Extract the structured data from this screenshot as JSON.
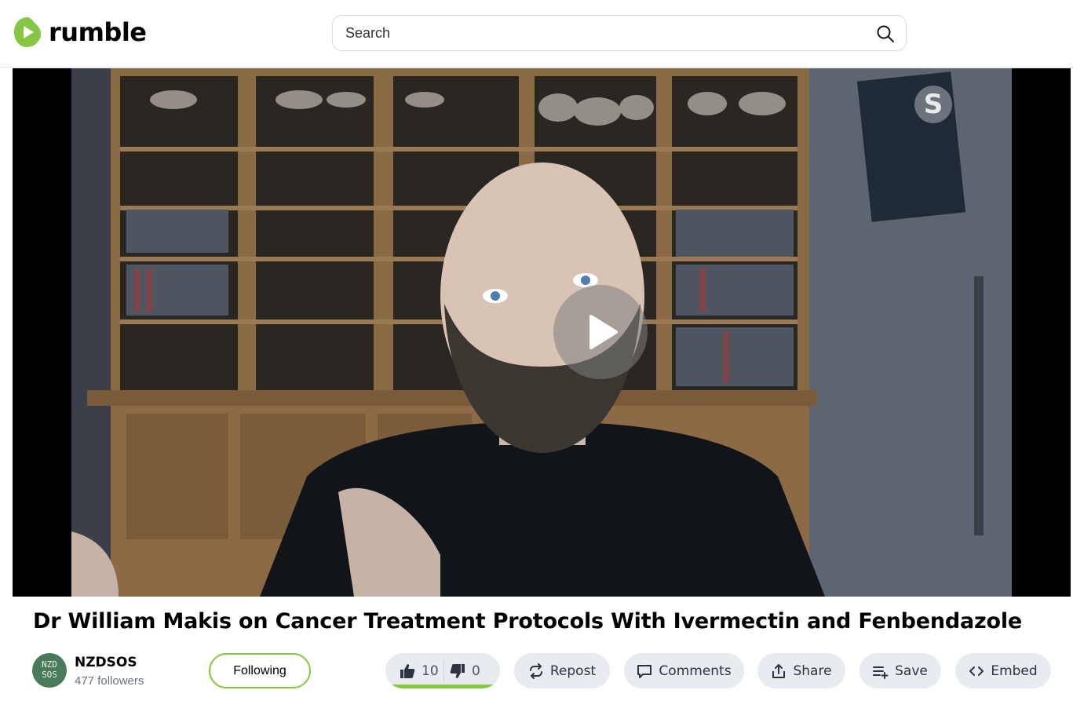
{
  "header": {
    "logo_text": "rumble",
    "search_placeholder": "Search"
  },
  "video": {
    "title": "Dr William Makis on Cancer Treatment Protocols With Ivermectin and Fenbendazole",
    "watermark": "S"
  },
  "channel": {
    "name": "NZDSOS",
    "followers": "477 followers",
    "avatar_text": "NZD SOS",
    "follow_label": "Following"
  },
  "actions": {
    "likes": "10",
    "dislikes": "0",
    "like_ratio": 1.0,
    "repost_label": "Repost",
    "comments_label": "Comments",
    "share_label": "Share",
    "save_label": "Save",
    "embed_label": "Embed"
  },
  "colors": {
    "brand_green": "#85c742",
    "pill_bg": "#e8ebef"
  }
}
